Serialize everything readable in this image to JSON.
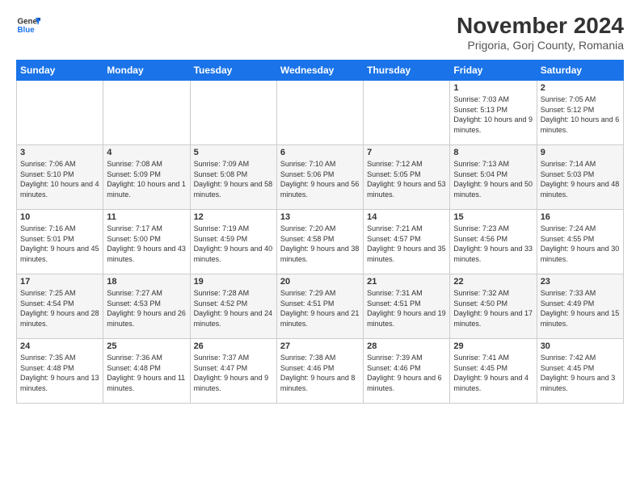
{
  "logo": {
    "line1": "General",
    "line2": "Blue"
  },
  "title": "November 2024",
  "location": "Prigoria, Gorj County, Romania",
  "weekdays": [
    "Sunday",
    "Monday",
    "Tuesday",
    "Wednesday",
    "Thursday",
    "Friday",
    "Saturday"
  ],
  "weeks": [
    [
      {
        "day": "",
        "info": ""
      },
      {
        "day": "",
        "info": ""
      },
      {
        "day": "",
        "info": ""
      },
      {
        "day": "",
        "info": ""
      },
      {
        "day": "",
        "info": ""
      },
      {
        "day": "1",
        "info": "Sunrise: 7:03 AM\nSunset: 5:13 PM\nDaylight: 10 hours and 9 minutes."
      },
      {
        "day": "2",
        "info": "Sunrise: 7:05 AM\nSunset: 5:12 PM\nDaylight: 10 hours and 6 minutes."
      }
    ],
    [
      {
        "day": "3",
        "info": "Sunrise: 7:06 AM\nSunset: 5:10 PM\nDaylight: 10 hours and 4 minutes."
      },
      {
        "day": "4",
        "info": "Sunrise: 7:08 AM\nSunset: 5:09 PM\nDaylight: 10 hours and 1 minute."
      },
      {
        "day": "5",
        "info": "Sunrise: 7:09 AM\nSunset: 5:08 PM\nDaylight: 9 hours and 58 minutes."
      },
      {
        "day": "6",
        "info": "Sunrise: 7:10 AM\nSunset: 5:06 PM\nDaylight: 9 hours and 56 minutes."
      },
      {
        "day": "7",
        "info": "Sunrise: 7:12 AM\nSunset: 5:05 PM\nDaylight: 9 hours and 53 minutes."
      },
      {
        "day": "8",
        "info": "Sunrise: 7:13 AM\nSunset: 5:04 PM\nDaylight: 9 hours and 50 minutes."
      },
      {
        "day": "9",
        "info": "Sunrise: 7:14 AM\nSunset: 5:03 PM\nDaylight: 9 hours and 48 minutes."
      }
    ],
    [
      {
        "day": "10",
        "info": "Sunrise: 7:16 AM\nSunset: 5:01 PM\nDaylight: 9 hours and 45 minutes."
      },
      {
        "day": "11",
        "info": "Sunrise: 7:17 AM\nSunset: 5:00 PM\nDaylight: 9 hours and 43 minutes."
      },
      {
        "day": "12",
        "info": "Sunrise: 7:19 AM\nSunset: 4:59 PM\nDaylight: 9 hours and 40 minutes."
      },
      {
        "day": "13",
        "info": "Sunrise: 7:20 AM\nSunset: 4:58 PM\nDaylight: 9 hours and 38 minutes."
      },
      {
        "day": "14",
        "info": "Sunrise: 7:21 AM\nSunset: 4:57 PM\nDaylight: 9 hours and 35 minutes."
      },
      {
        "day": "15",
        "info": "Sunrise: 7:23 AM\nSunset: 4:56 PM\nDaylight: 9 hours and 33 minutes."
      },
      {
        "day": "16",
        "info": "Sunrise: 7:24 AM\nSunset: 4:55 PM\nDaylight: 9 hours and 30 minutes."
      }
    ],
    [
      {
        "day": "17",
        "info": "Sunrise: 7:25 AM\nSunset: 4:54 PM\nDaylight: 9 hours and 28 minutes."
      },
      {
        "day": "18",
        "info": "Sunrise: 7:27 AM\nSunset: 4:53 PM\nDaylight: 9 hours and 26 minutes."
      },
      {
        "day": "19",
        "info": "Sunrise: 7:28 AM\nSunset: 4:52 PM\nDaylight: 9 hours and 24 minutes."
      },
      {
        "day": "20",
        "info": "Sunrise: 7:29 AM\nSunset: 4:51 PM\nDaylight: 9 hours and 21 minutes."
      },
      {
        "day": "21",
        "info": "Sunrise: 7:31 AM\nSunset: 4:51 PM\nDaylight: 9 hours and 19 minutes."
      },
      {
        "day": "22",
        "info": "Sunrise: 7:32 AM\nSunset: 4:50 PM\nDaylight: 9 hours and 17 minutes."
      },
      {
        "day": "23",
        "info": "Sunrise: 7:33 AM\nSunset: 4:49 PM\nDaylight: 9 hours and 15 minutes."
      }
    ],
    [
      {
        "day": "24",
        "info": "Sunrise: 7:35 AM\nSunset: 4:48 PM\nDaylight: 9 hours and 13 minutes."
      },
      {
        "day": "25",
        "info": "Sunrise: 7:36 AM\nSunset: 4:48 PM\nDaylight: 9 hours and 11 minutes."
      },
      {
        "day": "26",
        "info": "Sunrise: 7:37 AM\nSunset: 4:47 PM\nDaylight: 9 hours and 9 minutes."
      },
      {
        "day": "27",
        "info": "Sunrise: 7:38 AM\nSunset: 4:46 PM\nDaylight: 9 hours and 8 minutes."
      },
      {
        "day": "28",
        "info": "Sunrise: 7:39 AM\nSunset: 4:46 PM\nDaylight: 9 hours and 6 minutes."
      },
      {
        "day": "29",
        "info": "Sunrise: 7:41 AM\nSunset: 4:45 PM\nDaylight: 9 hours and 4 minutes."
      },
      {
        "day": "30",
        "info": "Sunrise: 7:42 AM\nSunset: 4:45 PM\nDaylight: 9 hours and 3 minutes."
      }
    ]
  ]
}
